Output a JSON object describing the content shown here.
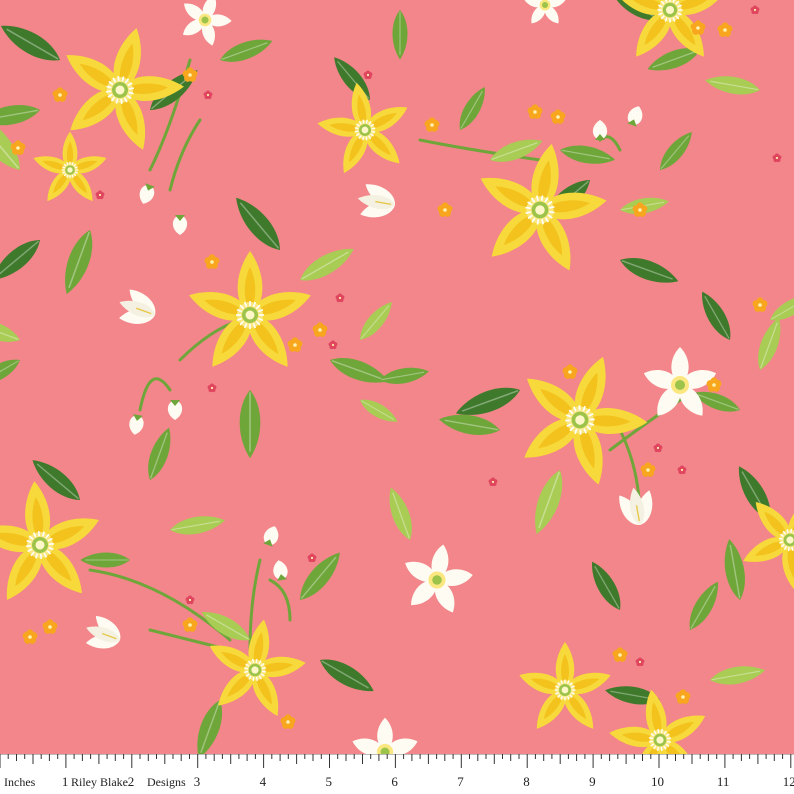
{
  "fabric": {
    "background_color": "#f2868a",
    "motif": "yellow and white flowers with green leaves on coral pink",
    "colors": {
      "yellow_petal": "#f7d93b",
      "yellow_petal_inner": "#f3c21d",
      "white_petal": "#fdfbf2",
      "leaf_dark": "#3f7a2c",
      "leaf_mid": "#6fa63a",
      "leaf_light": "#a9cc55",
      "small_orange": "#f8a61e",
      "small_pink": "#e0455f",
      "center_green": "#9cc34a"
    }
  },
  "ruler": {
    "unit_label": "Inches",
    "brand_name_left": "Riley Blake",
    "brand_name_right": "Designs",
    "numbers": [
      "1",
      "2",
      "3",
      "4",
      "5",
      "6",
      "7",
      "8",
      "9",
      "10",
      "11",
      "12"
    ],
    "background": "#ffffff",
    "text_color": "#222222"
  }
}
